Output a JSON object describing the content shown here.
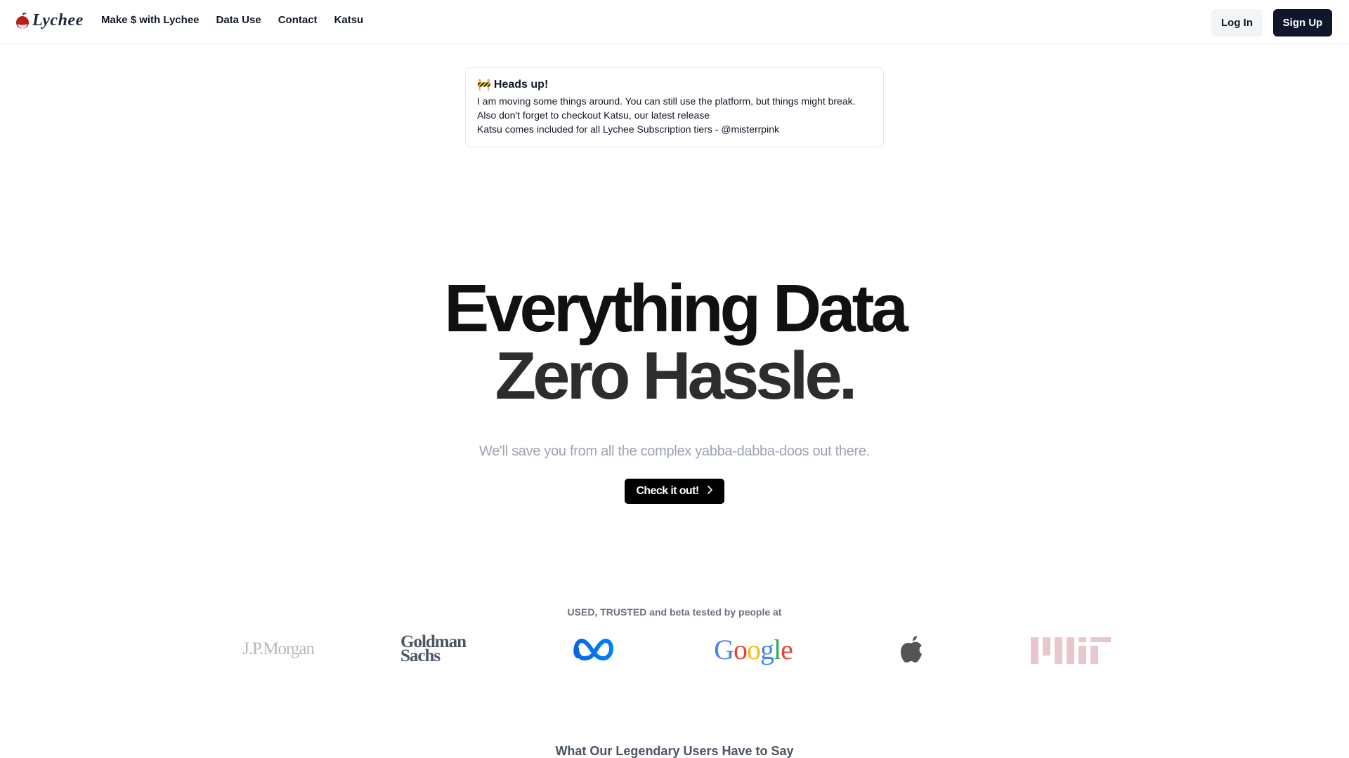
{
  "nav": {
    "brand": "Lychee",
    "links": [
      "Make $ with Lychee",
      "Data Use",
      "Contact",
      "Katsu"
    ],
    "login": "Log In",
    "signup": "Sign Up"
  },
  "alert": {
    "emoji": "🚧",
    "title": "Heads up!",
    "lines": [
      "I am moving some things around. You can still use the platform, but things might break.",
      "Also don't forget to checkout Katsu, our latest release",
      "Katsu comes included for all Lychee Subscription tiers - @misterrpink"
    ]
  },
  "hero": {
    "title_line1": "Everything Data",
    "title_line2": "Zero Hassle.",
    "subtitle": "We'll save you from all the complex yabba-dabba-doos out there.",
    "cta": "Check it out!"
  },
  "trusted": {
    "label": "USED, TRUSTED and beta tested by people at",
    "logos": {
      "jpmorgan": "J.P.Morgan",
      "goldman_line1": "Goldman",
      "goldman_line2": "Sachs",
      "google_letters": [
        "G",
        "o",
        "o",
        "g",
        "l",
        "e"
      ],
      "google_colors": [
        "#4285F4",
        "#EA4335",
        "#FBBC05",
        "#4285F4",
        "#34A853",
        "#EA4335"
      ]
    }
  },
  "testimonials": {
    "title": "What Our Legendary Users Have to Say"
  }
}
